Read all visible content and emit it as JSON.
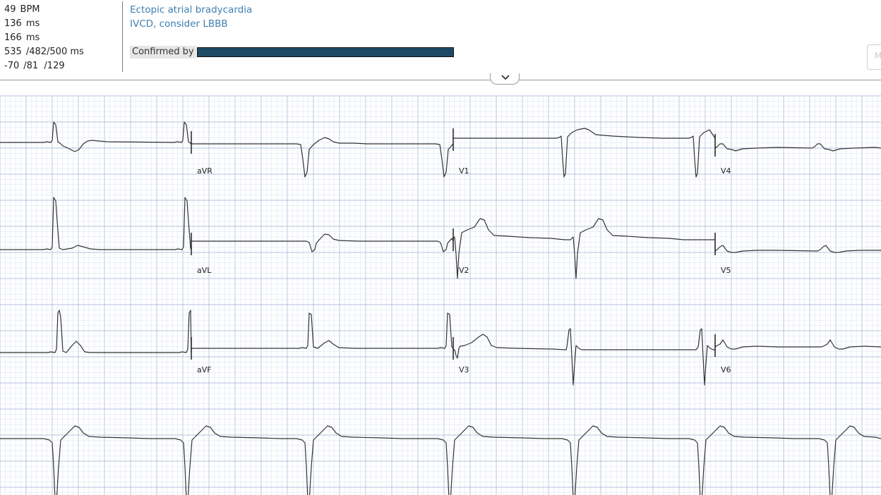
{
  "measurements": [
    {
      "value": "49",
      "unit": "BPM"
    },
    {
      "value": "136",
      "unit": "ms"
    },
    {
      "value": "166",
      "unit": "ms"
    },
    {
      "value": "535",
      "unit": "/482/500 ms"
    },
    {
      "value": "-70",
      "unit": "/81  /129"
    }
  ],
  "interpretation": {
    "lines": [
      "Ectopic atrial bradycardia",
      "IVCD, consider LBBB"
    ],
    "confirmed_label": "Confirmed by"
  },
  "side_tab": {
    "label": "M"
  },
  "lead_labels": {
    "avr": "aVR",
    "v1": "V1",
    "v4": "V4",
    "avl": "aVL",
    "v2": "V2",
    "v5": "V5",
    "avf": "aVF",
    "v3": "V3",
    "v6": "V6"
  },
  "colors": {
    "grid_minor": "#dfe6f3",
    "grid_major": "#b4c3de",
    "trace": "#333333",
    "interpretation_text": "#3d7fb0",
    "redaction": "#1f4a66"
  },
  "icons": {
    "collapse": "chevron-down-icon"
  }
}
